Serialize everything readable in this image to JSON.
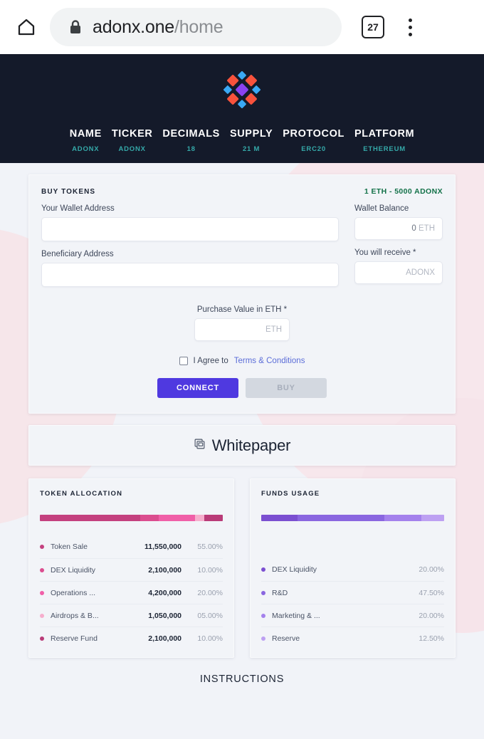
{
  "browser": {
    "home_icon": "home-icon",
    "lock_icon": "lock-icon",
    "url_domain": "adonx.one",
    "url_path": "/home",
    "tab_count": "27",
    "menu_icon": "more-vertical-icon"
  },
  "header": {
    "logo_icon": "adonx-diamond-logo",
    "stats": [
      {
        "label": "NAME",
        "value": "ADONX"
      },
      {
        "label": "TICKER",
        "value": "ADONX"
      },
      {
        "label": "DECIMALS",
        "value": "18"
      },
      {
        "label": "SUPPLY",
        "value": "21 M"
      },
      {
        "label": "PROTOCOL",
        "value": "ERC20"
      },
      {
        "label": "PLATFORM",
        "value": "ETHEREUM"
      }
    ],
    "bg_color": "#141a2a",
    "value_color": "#35a9a9"
  },
  "buy_tokens": {
    "title": "BUY TOKENS",
    "rate": "1 ETH - 5000 ADONX",
    "rate_color": "#127148",
    "wallet_address_label": "Your Wallet Address",
    "wallet_address_value": "",
    "beneficiary_label": "Beneficiary Address",
    "beneficiary_value": "",
    "wallet_balance_label": "Wallet Balance",
    "wallet_balance_amount": "0",
    "wallet_balance_unit": "ETH",
    "receive_label": "You will receive *",
    "receive_placeholder": "ADONX",
    "purchase_label": "Purchase Value in ETH *",
    "purchase_placeholder": "ETH",
    "agree_text": "I Agree to",
    "terms_link": "Terms & Conditions",
    "connect_label": "CONNECT",
    "buy_label": "BUY",
    "connect_color": "#4f39e0"
  },
  "whitepaper": {
    "icon": "copy-pages-icon",
    "label": "Whitepaper"
  },
  "chart_data": [
    {
      "type": "bar",
      "title": "TOKEN ALLOCATION",
      "orientation": "stacked-horizontal",
      "categories": [
        "Token Sale",
        "DEX Liquidity",
        "Operations ...",
        "Airdrops & B...",
        "Reserve Fund"
      ],
      "values": [
        55.0,
        10.0,
        20.0,
        5.0,
        10.0
      ],
      "amounts": [
        "11,550,000",
        "2,100,000",
        "4,200,000",
        "1,050,000",
        "2,100,000"
      ],
      "percent_labels": [
        "55.00%",
        "10.00%",
        "20.00%",
        "05.00%",
        "10.00%"
      ],
      "colors": [
        "#c4407f",
        "#db4d8f",
        "#f05fa8",
        "#f6aecd",
        "#b93b78"
      ],
      "xlabel": "",
      "ylabel": "",
      "legend": "below-bar"
    },
    {
      "type": "bar",
      "title": "FUNDS USAGE",
      "orientation": "stacked-horizontal",
      "categories": [
        "DEX Liquidity",
        "R&D",
        "Marketing & ...",
        "Reserve"
      ],
      "values": [
        20.0,
        47.5,
        20.0,
        12.5
      ],
      "percent_labels": [
        "20.00%",
        "47.50%",
        "20.00%",
        "12.50%"
      ],
      "colors": [
        "#7b4fd1",
        "#8a66e0",
        "#a481ec",
        "#bda0f2"
      ],
      "xlabel": "",
      "ylabel": "",
      "legend": "below-bar"
    }
  ],
  "footer": {
    "instructions": "INSTRUCTIONS"
  }
}
